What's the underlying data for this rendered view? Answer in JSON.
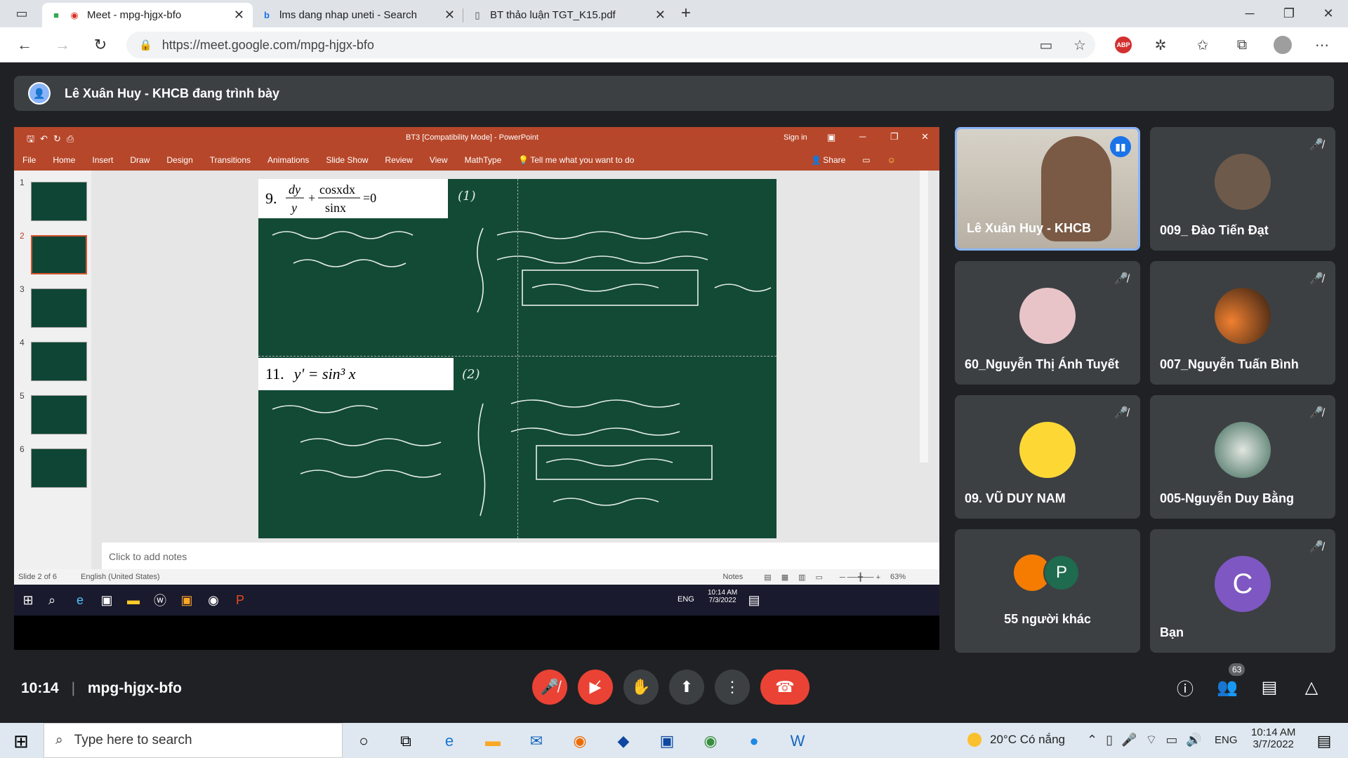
{
  "browser": {
    "tabs": [
      {
        "title": "Meet - mpg-hjgx-bfo",
        "active": true
      },
      {
        "title": "lms dang nhap uneti - Search",
        "active": false
      },
      {
        "title": "BT thảo luận TGT_K15.pdf",
        "active": false
      }
    ],
    "url": "https://meet.google.com/mpg-hjgx-bfo",
    "abp_label": "ABP"
  },
  "meet": {
    "presenter_banner": "Lê Xuân Huy - KHCB đang trình bày",
    "participants": [
      {
        "name": "Lê Xuân Huy - KHCB",
        "speaking": true
      },
      {
        "name": "009_ Đào Tiến Đạt",
        "muted": true
      },
      {
        "name": "60_Nguyễn Thị Ánh Tuyết",
        "muted": true
      },
      {
        "name": "007_Nguyễn Tuấn Bình",
        "muted": true
      },
      {
        "name": "09. VŨ DUY NAM",
        "muted": true
      },
      {
        "name": "005-Nguyễn Duy Bằng",
        "muted": true
      },
      {
        "name": "55 người khác",
        "avatar_letter": "P"
      },
      {
        "name": "Bạn",
        "avatar_letter": "C",
        "muted": true
      }
    ],
    "time": "10:14",
    "meeting_code": "mpg-hjgx-bfo",
    "participant_count": "63"
  },
  "powerpoint": {
    "title": "BT3 [Compatibility Mode] - PowerPoint",
    "sign_in": "Sign in",
    "ribbon_tabs": [
      "File",
      "Home",
      "Insert",
      "Draw",
      "Design",
      "Transitions",
      "Animations",
      "Slide Show",
      "Review",
      "View",
      "MathType"
    ],
    "tell_me": "Tell me what you want to do",
    "share": "Share",
    "slide_numbers": [
      "1",
      "2",
      "3",
      "4",
      "5",
      "6"
    ],
    "notes_placeholder": "Click to add notes",
    "status_slide": "Slide 2 of 6",
    "status_lang": "English (United States)",
    "status_notes": "Notes",
    "zoom": "63%",
    "slide": {
      "eq9_number": "9.",
      "eq9_label": "(1)",
      "eq11_number": "11.",
      "eq11_text": "y' = sin³ x",
      "eq11_label": "(2)"
    },
    "taskbar_time": "10:14 AM",
    "taskbar_date": "7/3/2022",
    "taskbar_lang": "ENG"
  },
  "taskbar": {
    "search_placeholder": "Type here to search",
    "weather": "20°C  Có nắng",
    "lang": "ENG",
    "time": "10:14 AM",
    "date": "3/7/2022"
  }
}
